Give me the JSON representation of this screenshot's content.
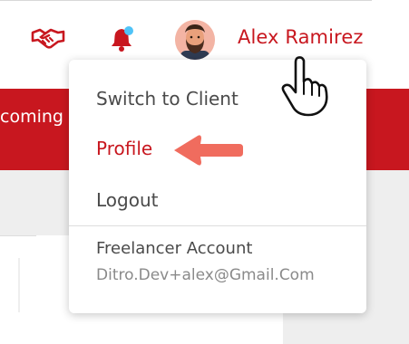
{
  "header": {
    "user_name": "Alex Ramirez",
    "icons": [
      "handshake-icon",
      "bell-icon",
      "avatar"
    ],
    "accent_color": "#c8171f",
    "notification_dot_color": "#4fc3f7"
  },
  "background": {
    "banner_text": "coming"
  },
  "dropdown": {
    "items": [
      {
        "label": "Switch to Client"
      },
      {
        "label": "Profile",
        "active": true
      },
      {
        "label": "Logout"
      }
    ],
    "account_type": "Freelancer Account",
    "account_email": "Ditro.Dev+alex@Gmail.Com"
  },
  "annotations": {
    "arrow_color": "#f06c5e",
    "cursor": "pointer-hand-icon"
  }
}
